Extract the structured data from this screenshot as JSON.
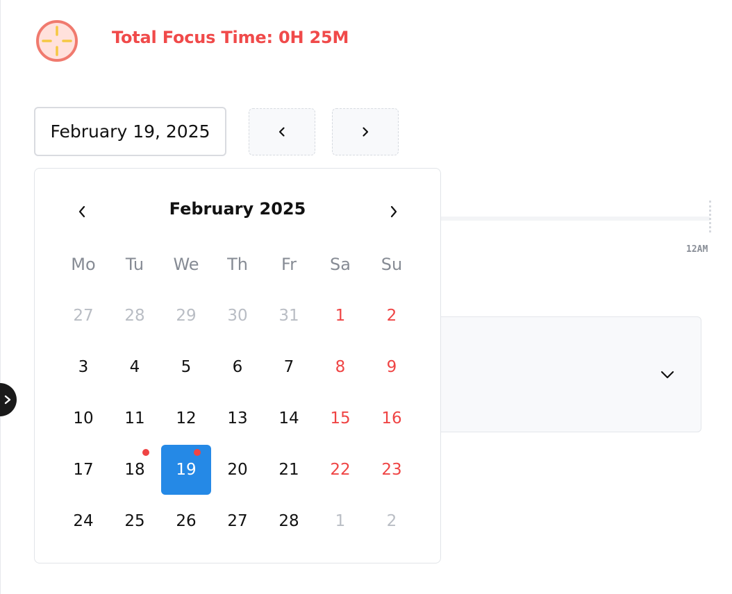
{
  "header": {
    "logo_icon": "crosshair-target-icon",
    "title": "Total Focus Time: 0H 25M",
    "title_color": "#f04a4a"
  },
  "date_picker": {
    "value": "February 19, 2025",
    "prev_icon": "chevron-left-icon",
    "next_icon": "chevron-right-icon"
  },
  "calendar": {
    "title": "February 2025",
    "weekdays": [
      "Mo",
      "Tu",
      "We",
      "Th",
      "Fr",
      "Sa",
      "Su"
    ],
    "weeks": [
      [
        {
          "d": "27",
          "m": true
        },
        {
          "d": "28",
          "m": true
        },
        {
          "d": "29",
          "m": true
        },
        {
          "d": "30",
          "m": true
        },
        {
          "d": "31",
          "m": true
        },
        {
          "d": "1",
          "w": true
        },
        {
          "d": "2",
          "w": true
        }
      ],
      [
        {
          "d": "3"
        },
        {
          "d": "4"
        },
        {
          "d": "5"
        },
        {
          "d": "6"
        },
        {
          "d": "7"
        },
        {
          "d": "8",
          "w": true
        },
        {
          "d": "9",
          "w": true
        }
      ],
      [
        {
          "d": "10"
        },
        {
          "d": "11"
        },
        {
          "d": "12"
        },
        {
          "d": "13"
        },
        {
          "d": "14"
        },
        {
          "d": "15",
          "w": true
        },
        {
          "d": "16",
          "w": true
        }
      ],
      [
        {
          "d": "17"
        },
        {
          "d": "18",
          "dot": true
        },
        {
          "d": "19",
          "sel": true,
          "dot": true
        },
        {
          "d": "20"
        },
        {
          "d": "21"
        },
        {
          "d": "22",
          "w": true
        },
        {
          "d": "23",
          "w": true
        }
      ],
      [
        {
          "d": "24"
        },
        {
          "d": "25"
        },
        {
          "d": "26"
        },
        {
          "d": "27"
        },
        {
          "d": "28"
        },
        {
          "d": "1",
          "m": true
        },
        {
          "d": "2",
          "m": true
        }
      ]
    ],
    "selected_color": "#2589e6",
    "weekend_color": "#ef4444",
    "dot_color": "#ef4444"
  },
  "timeline": {
    "end_label": "12AM"
  },
  "panel": {
    "expand_icon": "chevron-down-icon"
  },
  "sidebar_toggle": {
    "icon": "chevron-right-icon"
  }
}
